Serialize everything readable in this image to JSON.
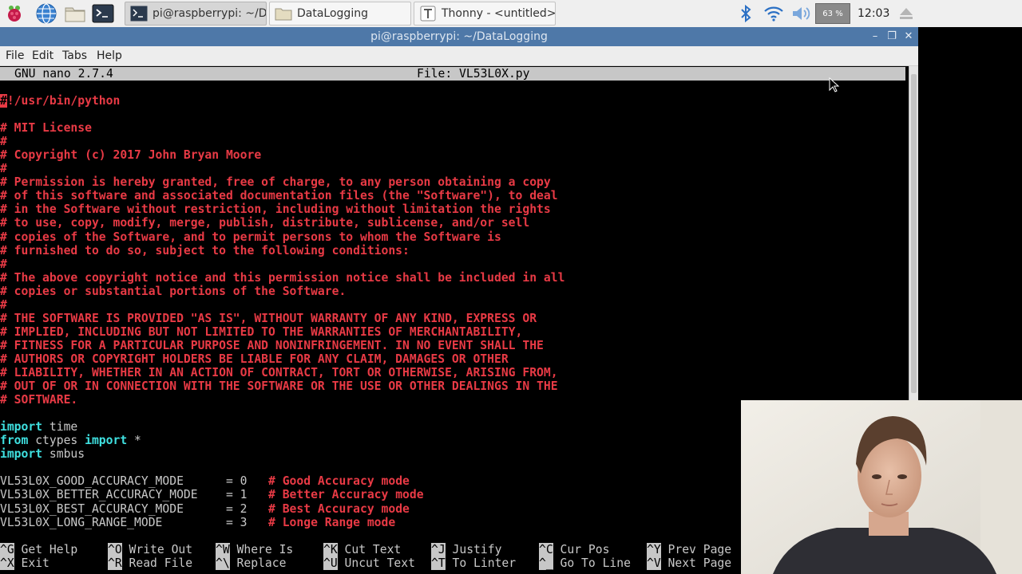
{
  "taskbar": {
    "launchers": [
      "raspberry-menu-icon",
      "web-browser-icon",
      "file-manager-icon",
      "terminal-icon"
    ],
    "tasks": [
      {
        "label": "pi@raspberrypi: ~/Da...",
        "icon": "terminal-icon",
        "active": true
      },
      {
        "label": "DataLogging",
        "icon": "folder-icon",
        "active": false
      },
      {
        "label": "Thonny  -  <untitled>  ...",
        "icon": "thonny-icon",
        "active": false
      }
    ],
    "tray": {
      "cpu": "63 %",
      "clock": "12:03"
    }
  },
  "window": {
    "title": "pi@raspberrypi: ~/DataLogging",
    "menu": [
      "File",
      "Edit",
      "Tabs",
      "Help"
    ]
  },
  "nano": {
    "version": "GNU nano 2.7.4",
    "file": "File: VL53L0X.py",
    "lines": [
      {
        "t": "shebang",
        "text": "!/usr/bin/python"
      },
      {
        "t": "blank"
      },
      {
        "t": "comment",
        "text": "# MIT License"
      },
      {
        "t": "comment",
        "text": "#"
      },
      {
        "t": "comment",
        "text": "# Copyright (c) 2017 John Bryan Moore"
      },
      {
        "t": "comment",
        "text": "#"
      },
      {
        "t": "comment",
        "text": "# Permission is hereby granted, free of charge, to any person obtaining a copy"
      },
      {
        "t": "comment",
        "text": "# of this software and associated documentation files (the \"Software\"), to deal"
      },
      {
        "t": "comment",
        "text": "# in the Software without restriction, including without limitation the rights"
      },
      {
        "t": "comment",
        "text": "# to use, copy, modify, merge, publish, distribute, sublicense, and/or sell"
      },
      {
        "t": "comment",
        "text": "# copies of the Software, and to permit persons to whom the Software is"
      },
      {
        "t": "comment",
        "text": "# furnished to do so, subject to the following conditions:"
      },
      {
        "t": "comment",
        "text": "#"
      },
      {
        "t": "comment",
        "text": "# The above copyright notice and this permission notice shall be included in all"
      },
      {
        "t": "comment",
        "text": "# copies or substantial portions of the Software."
      },
      {
        "t": "comment",
        "text": "#"
      },
      {
        "t": "comment",
        "text": "# THE SOFTWARE IS PROVIDED \"AS IS\", WITHOUT WARRANTY OF ANY KIND, EXPRESS OR"
      },
      {
        "t": "comment",
        "text": "# IMPLIED, INCLUDING BUT NOT LIMITED TO THE WARRANTIES OF MERCHANTABILITY,"
      },
      {
        "t": "comment",
        "text": "# FITNESS FOR A PARTICULAR PURPOSE AND NONINFRINGEMENT. IN NO EVENT SHALL THE"
      },
      {
        "t": "comment",
        "text": "# AUTHORS OR COPYRIGHT HOLDERS BE LIABLE FOR ANY CLAIM, DAMAGES OR OTHER"
      },
      {
        "t": "comment",
        "text": "# LIABILITY, WHETHER IN AN ACTION OF CONTRACT, TORT OR OTHERWISE, ARISING FROM,"
      },
      {
        "t": "comment",
        "text": "# OUT OF OR IN CONNECTION WITH THE SOFTWARE OR THE USE OR OTHER DEALINGS IN THE"
      },
      {
        "t": "comment",
        "text": "# SOFTWARE."
      },
      {
        "t": "blank"
      },
      {
        "t": "code",
        "parts": [
          [
            "kw",
            "import"
          ],
          [
            "plain",
            " time"
          ]
        ]
      },
      {
        "t": "code",
        "parts": [
          [
            "kw",
            "from"
          ],
          [
            "plain",
            " ctypes "
          ],
          [
            "kw",
            "import"
          ],
          [
            "plain",
            " *"
          ]
        ]
      },
      {
        "t": "code",
        "parts": [
          [
            "kw",
            "import"
          ],
          [
            "plain",
            " smbus"
          ]
        ]
      },
      {
        "t": "blank"
      },
      {
        "t": "code",
        "parts": [
          [
            "plain",
            "VL53L0X_GOOD_ACCURACY_MODE      = 0   "
          ],
          [
            "red",
            "# Good Accuracy mode"
          ]
        ]
      },
      {
        "t": "code",
        "parts": [
          [
            "plain",
            "VL53L0X_BETTER_ACCURACY_MODE    = 1   "
          ],
          [
            "red",
            "# Better Accuracy mode"
          ]
        ]
      },
      {
        "t": "code",
        "parts": [
          [
            "plain",
            "VL53L0X_BEST_ACCURACY_MODE      = 2   "
          ],
          [
            "red",
            "# Best Accuracy mode"
          ]
        ]
      },
      {
        "t": "code",
        "parts": [
          [
            "plain",
            "VL53L0X_LONG_RANGE_MODE         = 3   "
          ],
          [
            "red",
            "# Longe Range mode"
          ]
        ]
      }
    ],
    "shortcuts_row1": [
      {
        "key": "^G",
        "label": "Get Help"
      },
      {
        "key": "^O",
        "label": "Write Out"
      },
      {
        "key": "^W",
        "label": "Where Is"
      },
      {
        "key": "^K",
        "label": "Cut Text"
      },
      {
        "key": "^J",
        "label": "Justify"
      },
      {
        "key": "^C",
        "label": "Cur Pos"
      },
      {
        "key": "^Y",
        "label": "Prev Page"
      }
    ],
    "shortcuts_row2": [
      {
        "key": "^X",
        "label": "Exit"
      },
      {
        "key": "^R",
        "label": "Read File"
      },
      {
        "key": "^\\",
        "label": "Replace"
      },
      {
        "key": "^U",
        "label": "Uncut Text"
      },
      {
        "key": "^T",
        "label": "To Linter"
      },
      {
        "key": "^_",
        "label": "Go To Line"
      },
      {
        "key": "^V",
        "label": "Next Page"
      }
    ]
  },
  "colors": {
    "titlebar": "#4e78a8",
    "comment": "#e83a45",
    "keyword": "#3fe0e0",
    "header_bg": "#c7c7c7"
  }
}
